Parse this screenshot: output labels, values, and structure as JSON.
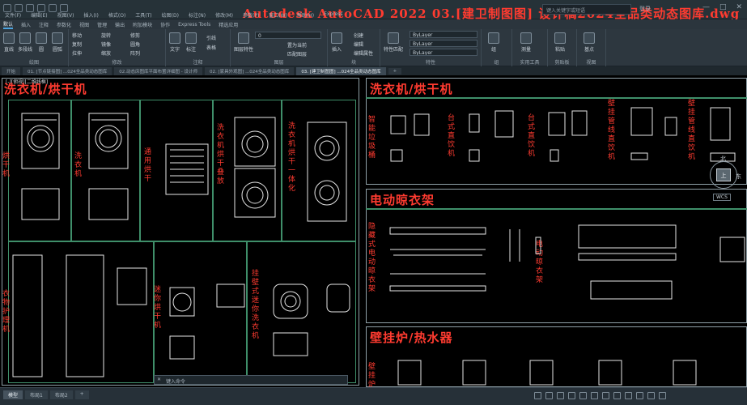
{
  "app": {
    "title": "Autodesk AutoCAD 2022   03.[建卫制图图]  设计稿2024全品类动态图库.dwg",
    "search_placeholder": "键入关键字或短语",
    "user": "登录",
    "window_controls": [
      "—",
      "□",
      "✕"
    ]
  },
  "menubar": [
    "文件(F)",
    "编辑(E)",
    "视图(V)",
    "插入(I)",
    "格式(O)",
    "工具(T)",
    "绘图(D)",
    "标注(N)",
    "修改(M)",
    "参数(P)",
    "窗口(W)",
    "帮助(H)",
    "Express"
  ],
  "ribbon_tabs": [
    "默认",
    "插入",
    "注释",
    "参数化",
    "视图",
    "管理",
    "输出",
    "附加模块",
    "协作",
    "Express Tools",
    "精选应用"
  ],
  "ribbon": {
    "draw": {
      "label": "绘图",
      "tools": [
        "直线",
        "多段线",
        "圆",
        "圆弧"
      ]
    },
    "modify": {
      "label": "修改",
      "tools": [
        "移动",
        "旋转",
        "修剪",
        "复制",
        "镜像",
        "圆角",
        "拉伸",
        "缩放",
        "阵列"
      ]
    },
    "annotation": {
      "label": "注释",
      "tools": [
        "文字",
        "标注",
        "引线",
        "表格"
      ]
    },
    "layers": {
      "label": "图层",
      "current": "0",
      "tools": [
        "图层特性",
        "置为当前",
        "匹配图层"
      ]
    },
    "block": {
      "label": "块",
      "tools": [
        "插入",
        "创建",
        "编辑",
        "编辑属性"
      ]
    },
    "properties": {
      "label": "特性",
      "tools": [
        "特性匹配"
      ],
      "color": "ByLayer",
      "linetype": "ByLayer",
      "lineweight": "ByLayer"
    },
    "groups": {
      "label": "组",
      "tools": [
        "组"
      ]
    },
    "utilities": {
      "label": "实用工具",
      "tools": [
        "测量"
      ]
    },
    "clipboard": {
      "label": "剪贴板",
      "tools": [
        "粘贴"
      ]
    },
    "view": {
      "label": "视图",
      "tools": [
        "基点"
      ]
    }
  },
  "doc_tabs": [
    {
      "label": "开始",
      "active": false
    },
    {
      "label": "01. [节点链接图] ...024全品类动态图库",
      "active": false
    },
    {
      "label": "02.动态床图库平面布置详细图 - 设计师",
      "active": false
    },
    {
      "label": "02. [家具外观图] ...024全品类动态图库",
      "active": false
    },
    {
      "label": "03. [建卫制图图] ...024全品类动态图库",
      "active": true
    },
    {
      "label": "+",
      "active": false
    }
  ],
  "viewport_caption": "[-][俯视][二维线框]",
  "viewcube": {
    "north": "北",
    "east": "东",
    "top": "上",
    "wcs": "WCS"
  },
  "left_section": {
    "title": "洗衣机/烘干机",
    "labels": {
      "dryer": "烘干机",
      "washer": "洗衣机",
      "general_dryer": "通用烘干",
      "stack": "洗衣机烘干叠放",
      "combo": "洗衣机烘干一体化",
      "care_cabinet": "衣物护理机",
      "mini_dryer": "迷你烘干机",
      "wall_washer": "挂壁式迷你洗衣机"
    }
  },
  "right_sections": {
    "appliances_title": "洗衣机/烘干机",
    "appliance_labels": [
      "智能垃圾桶",
      "台式直饮机",
      "台式直饮机",
      "壁挂管线直饮机",
      "壁挂管线直饮机"
    ],
    "airer_title": "电动晾衣架",
    "airer_labels": [
      "隐藏式电动晾衣架",
      "电动晾衣架"
    ],
    "heater_title": "壁挂炉/热水器",
    "heater_labels": [
      "壁挂炉"
    ]
  },
  "command_line": {
    "close": "✕",
    "placeholder": "键入命令"
  },
  "layout_tabs": [
    {
      "label": "模型",
      "active": true
    },
    {
      "label": "布局1",
      "active": false
    },
    {
      "label": "布局2",
      "active": false
    },
    {
      "label": "+",
      "active": false
    }
  ],
  "colors": {
    "title_red": "#ff3b30",
    "frame": "#8fa0a8",
    "cell": "#3f8f6a",
    "ribbon_bg": "#2d373f"
  }
}
